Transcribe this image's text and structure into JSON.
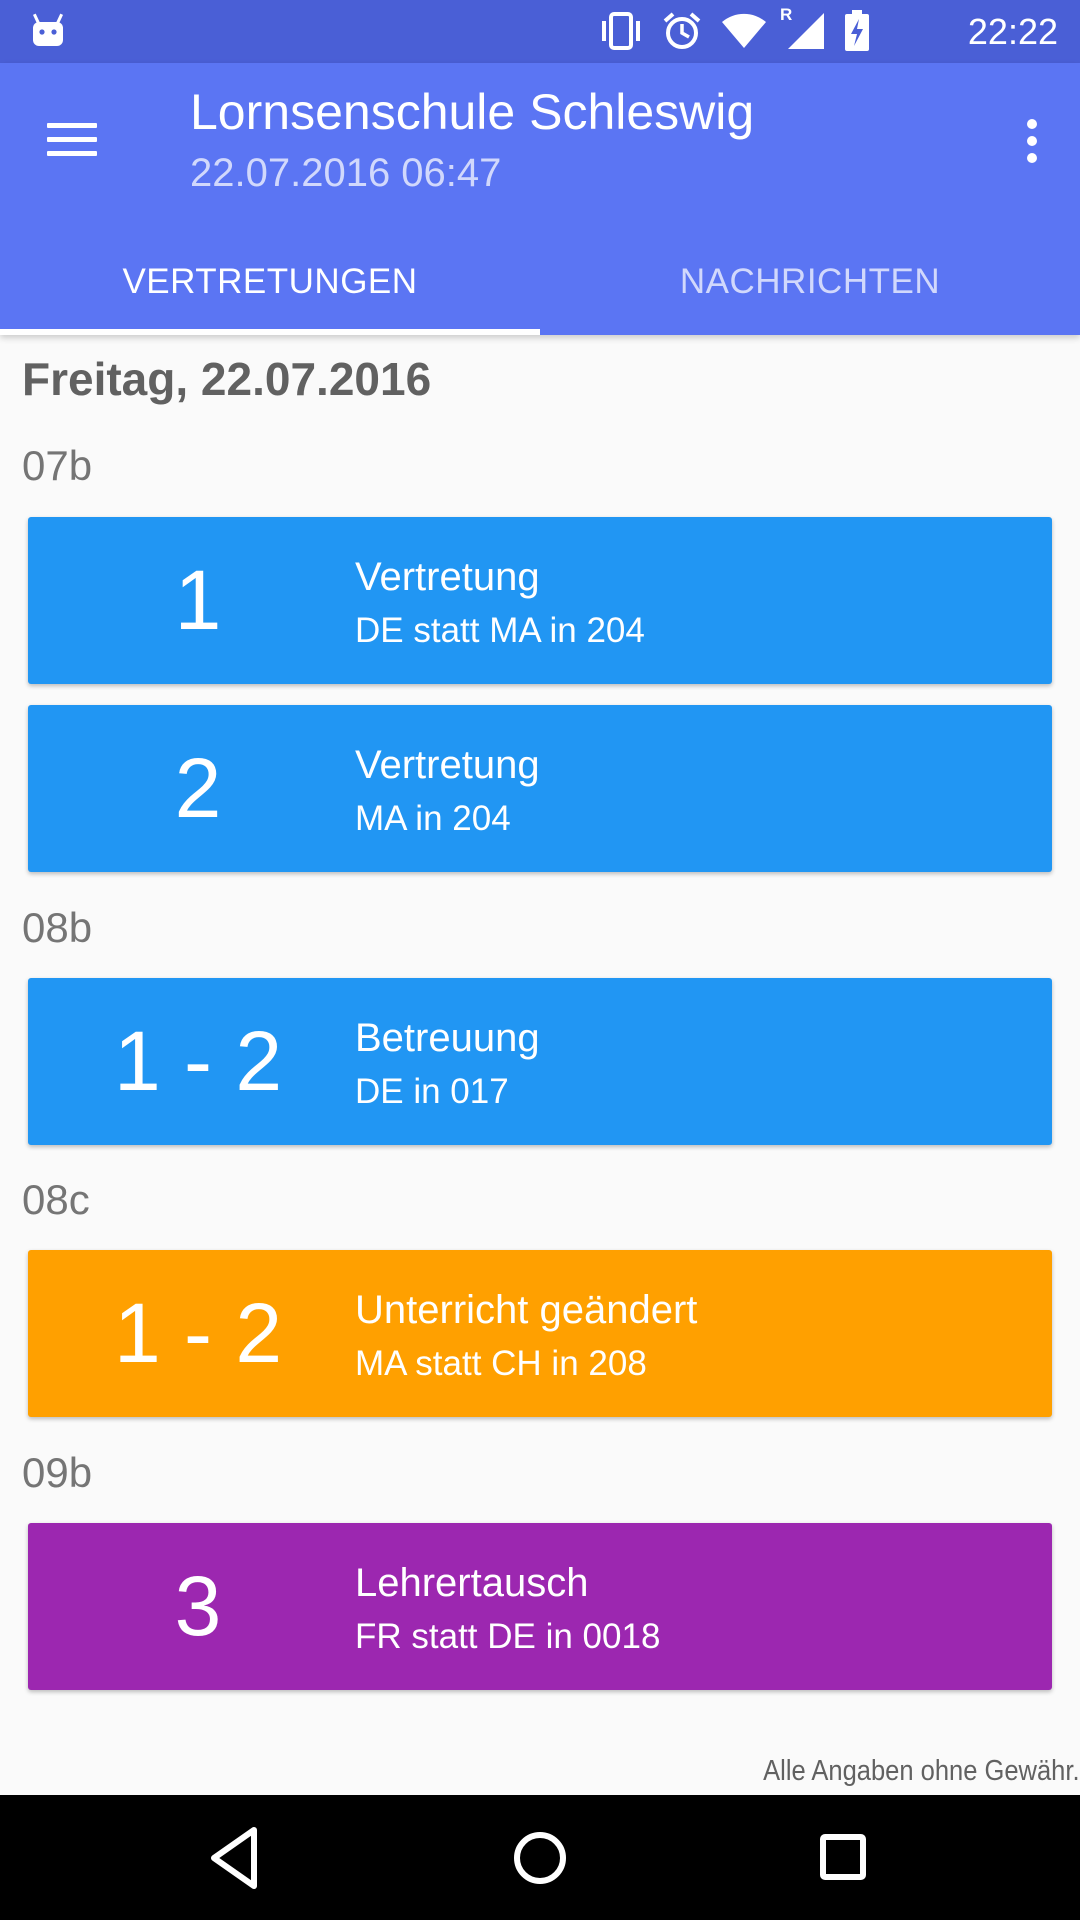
{
  "status_bar": {
    "time": "22:22",
    "roaming_indicator": "R",
    "icons": [
      "android-icon",
      "vibrate-icon",
      "alarm-icon",
      "wifi-icon",
      "signal-icon",
      "battery-charging-icon"
    ]
  },
  "app_bar": {
    "title": "Lornsenschule Schleswig",
    "subtitle": "22.07.2016 06:47",
    "menu_icon": "hamburger-menu-icon",
    "overflow_icon": "more-vert-icon"
  },
  "tabs": [
    {
      "label": "VERTRETUNGEN",
      "selected": true
    },
    {
      "label": "NACHRICHTEN",
      "selected": false
    }
  ],
  "day": {
    "heading": "Freitag, 22.07.2016",
    "groups": [
      {
        "class": "07b",
        "entries": [
          {
            "lesson": "1",
            "type": "Vertretung",
            "detail": "DE statt MA in 204",
            "color": "#2196f3"
          },
          {
            "lesson": "2",
            "type": "Vertretung",
            "detail": "MA in 204",
            "color": "#2196f3"
          }
        ]
      },
      {
        "class": "08b",
        "entries": [
          {
            "lesson": "1 - 2",
            "type": "Betreuung",
            "detail": "DE in 017",
            "color": "#2196f3"
          }
        ]
      },
      {
        "class": "08c",
        "entries": [
          {
            "lesson": "1 - 2",
            "type": "Unterricht geändert",
            "detail": "MA statt CH in 208",
            "color": "#ffa000"
          }
        ]
      },
      {
        "class": "09b",
        "entries": [
          {
            "lesson": "3",
            "type": "Lehrertausch",
            "detail": "FR statt DE in 0018",
            "color": "#9c27b0"
          }
        ]
      }
    ]
  },
  "footer_note": "Alle Angaben ohne Gewähr.",
  "nav_bar": {
    "buttons": [
      "back-icon",
      "home-icon",
      "recents-icon"
    ]
  }
}
